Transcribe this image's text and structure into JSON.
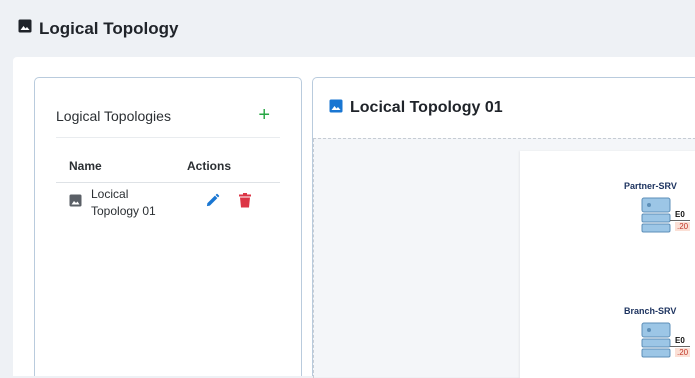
{
  "header": {
    "title": "Logical Topology",
    "icon": "image-icon"
  },
  "left_panel": {
    "title": "Logical Topologies",
    "add_icon": "+",
    "table": {
      "columns": [
        "Name",
        "Actions"
      ],
      "rows": [
        {
          "name": "Locical Topology 01",
          "icon": "image-icon",
          "actions": [
            "edit-icon",
            "delete-icon"
          ]
        }
      ]
    }
  },
  "right_panel": {
    "title": "Locical Topology 01",
    "icon": "picture-icon",
    "nodes": [
      {
        "name": "Partner-SRV",
        "interface": "E0",
        "ip": ".20"
      },
      {
        "name": "Branch-SRV",
        "interface": "E0",
        "ip": ".20"
      }
    ]
  },
  "colors": {
    "accent_blue": "#1976d2",
    "add_green": "#28a745",
    "delete_red": "#dc3545",
    "node_label": "#1e3460"
  }
}
